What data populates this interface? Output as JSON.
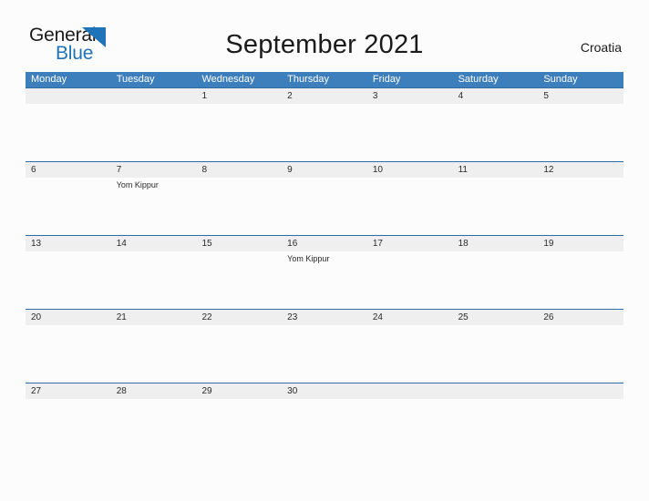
{
  "brand": {
    "name_part1": "General",
    "name_part2": "Blue",
    "flag_icon": "blue-triangle-flag-icon",
    "color_dark": "#1b1b1b",
    "color_blue": "#1f73b8"
  },
  "header": {
    "title": "September 2021",
    "country": "Croatia"
  },
  "theme": {
    "header_blue": "#3d7ebd",
    "rule_blue": "#2f6ca5",
    "date_strip_gray": "#efefef",
    "page_background": "#fcfcfd"
  },
  "calendar": {
    "weekdays": [
      "Monday",
      "Tuesday",
      "Wednesday",
      "Thursday",
      "Friday",
      "Saturday",
      "Sunday"
    ],
    "weeks": [
      [
        {
          "date": "",
          "events": []
        },
        {
          "date": "",
          "events": []
        },
        {
          "date": "1",
          "events": []
        },
        {
          "date": "2",
          "events": []
        },
        {
          "date": "3",
          "events": []
        },
        {
          "date": "4",
          "events": []
        },
        {
          "date": "5",
          "events": []
        }
      ],
      [
        {
          "date": "6",
          "events": []
        },
        {
          "date": "7",
          "events": [
            "Yom Kippur"
          ]
        },
        {
          "date": "8",
          "events": []
        },
        {
          "date": "9",
          "events": []
        },
        {
          "date": "10",
          "events": []
        },
        {
          "date": "11",
          "events": []
        },
        {
          "date": "12",
          "events": []
        }
      ],
      [
        {
          "date": "13",
          "events": []
        },
        {
          "date": "14",
          "events": []
        },
        {
          "date": "15",
          "events": []
        },
        {
          "date": "16",
          "events": [
            "Yom Kippur"
          ]
        },
        {
          "date": "17",
          "events": []
        },
        {
          "date": "18",
          "events": []
        },
        {
          "date": "19",
          "events": []
        }
      ],
      [
        {
          "date": "20",
          "events": []
        },
        {
          "date": "21",
          "events": []
        },
        {
          "date": "22",
          "events": []
        },
        {
          "date": "23",
          "events": []
        },
        {
          "date": "24",
          "events": []
        },
        {
          "date": "25",
          "events": []
        },
        {
          "date": "26",
          "events": []
        }
      ],
      [
        {
          "date": "27",
          "events": []
        },
        {
          "date": "28",
          "events": []
        },
        {
          "date": "29",
          "events": []
        },
        {
          "date": "30",
          "events": []
        },
        {
          "date": "",
          "events": []
        },
        {
          "date": "",
          "events": []
        },
        {
          "date": "",
          "events": []
        }
      ]
    ]
  }
}
